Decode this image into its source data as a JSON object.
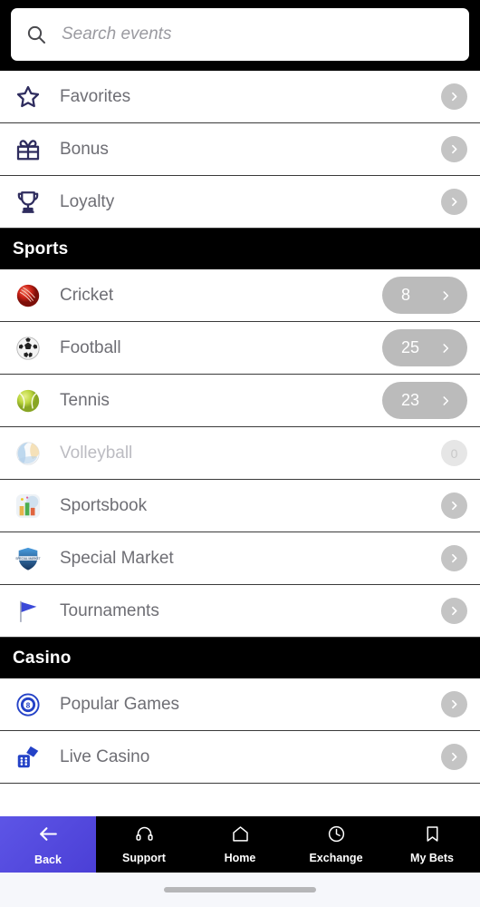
{
  "search": {
    "placeholder": "Search events",
    "value": "",
    "icon": "search-icon"
  },
  "quick_links": [
    {
      "label": "Favorites",
      "icon": "star-icon",
      "action": "chevron"
    },
    {
      "label": "Bonus",
      "icon": "gift-icon",
      "action": "chevron"
    },
    {
      "label": "Loyalty",
      "icon": "trophy-icon",
      "action": "chevron"
    }
  ],
  "sections": [
    {
      "title": "Sports",
      "items": [
        {
          "label": "Cricket",
          "icon": "cricket-ball-icon",
          "count": "8",
          "disabled": false
        },
        {
          "label": "Football",
          "icon": "soccer-ball-icon",
          "count": "25",
          "disabled": false
        },
        {
          "label": "Tennis",
          "icon": "tennis-ball-icon",
          "count": "23",
          "disabled": false
        },
        {
          "label": "Volleyball",
          "icon": "volleyball-icon",
          "count": "0",
          "disabled": true
        },
        {
          "label": "Sportsbook",
          "icon": "sportsbook-icon",
          "count": null,
          "disabled": false
        },
        {
          "label": "Special Market",
          "icon": "shield-icon",
          "count": null,
          "disabled": false
        },
        {
          "label": "Tournaments",
          "icon": "flag-icon",
          "count": null,
          "disabled": false
        }
      ]
    },
    {
      "title": "Casino",
      "items": [
        {
          "label": "Popular Games",
          "icon": "eight-ball-icon",
          "count": null,
          "disabled": false
        },
        {
          "label": "Live Casino",
          "icon": "dice-icon",
          "count": null,
          "disabled": false
        }
      ]
    }
  ],
  "bottom_nav": [
    {
      "label": "Back",
      "icon": "arrow-left-icon",
      "active": true
    },
    {
      "label": "Support",
      "icon": "headset-icon",
      "active": false
    },
    {
      "label": "Home",
      "icon": "home-icon",
      "active": false
    },
    {
      "label": "Exchange",
      "icon": "clock-icon",
      "active": false
    },
    {
      "label": "My Bets",
      "icon": "bookmark-icon",
      "active": false
    }
  ],
  "colors": {
    "accent": "#4b3fd6",
    "header_bg": "#000000",
    "label_text": "#6e6e74",
    "pill_bg": "#bbbbbb",
    "icon_navy": "#2e2c5e"
  }
}
